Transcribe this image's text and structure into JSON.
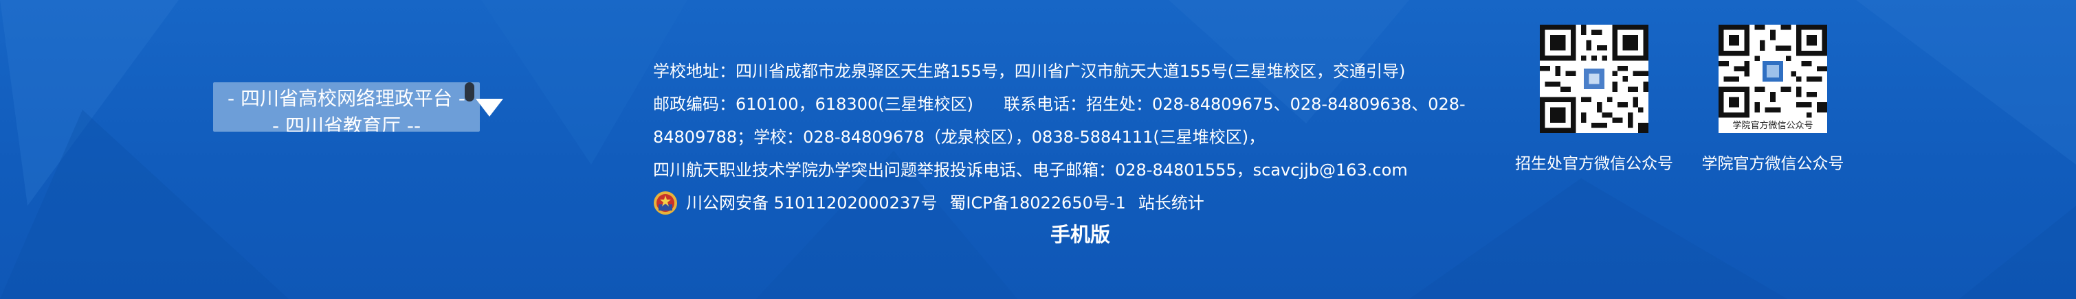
{
  "school_select": {
    "line1": "- 四川省高校网络理政平台 -",
    "line2": "- 四川省教育厅 --"
  },
  "contact": {
    "address": "学校地址：四川省成都市龙泉驿区天生路155号，四川省广汉市航天大道155号(三星堆校区，交通引导)",
    "postcode": "邮政编码：610100，618300(三星堆校区)",
    "phone_line1": "联系电话：招生处：028-84809675、028-84809638、028-",
    "phone_line2": "84809788；学校：028-84809678（龙泉校区），0838-5884111(三星堆校区)，",
    "report": "四川航天职业技术学院办学突出问题举报投诉电话、电子邮箱：028-84801555，scavcjjb@163.com",
    "police_record": "川公网安备 51011202000237号",
    "icp_record": "蜀ICP备18022650号-1",
    "site_stats": "站长统计"
  },
  "mobile_version": "手机版",
  "qr_codes": [
    {
      "caption": "招生处官方微信公众号",
      "icon": "qr-code-icon"
    },
    {
      "caption": "学院官方微信公众号",
      "icon": "qr-code-icon",
      "inner_label": "学院官方微信公众号"
    }
  ],
  "colors": {
    "background": "#1260c0",
    "select_background": "#6d9ed8",
    "text": "#ffffff"
  }
}
